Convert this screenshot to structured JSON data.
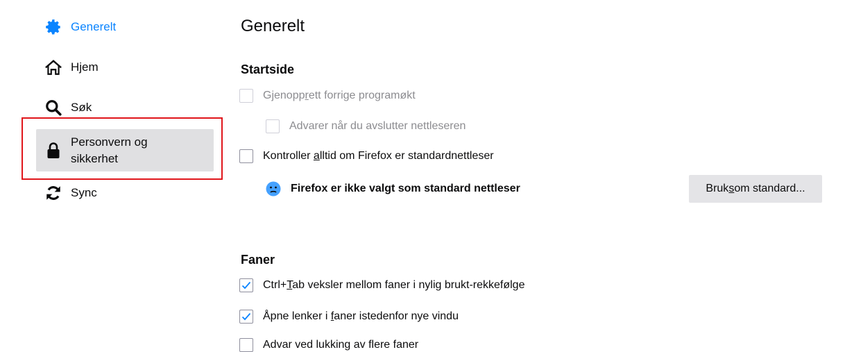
{
  "sidebar": {
    "items": [
      {
        "label": "Generelt",
        "icon": "gear-icon"
      },
      {
        "label": "Hjem",
        "icon": "home-icon"
      },
      {
        "label": "Søk",
        "icon": "search-icon"
      },
      {
        "label_line1": "Personvern og",
        "label_line2": "sikkerhet",
        "icon": "lock-icon"
      },
      {
        "label": "Sync",
        "icon": "sync-icon"
      }
    ]
  },
  "main": {
    "title": "Generelt",
    "startup": {
      "heading": "Startside",
      "restore_session": {
        "pre": "Gjenopp",
        "u": "r",
        "post": "ett forrige programøkt"
      },
      "warn_on_quit": "Advarer når du avslutter nettleseren",
      "check_default": {
        "pre": "Kontroller ",
        "u": "a",
        "post": "lltid om Firefox er standardnettleser"
      },
      "status": "Firefox er ikke valgt som standard nettleser",
      "make_default": {
        "pre": "Bruk ",
        "u": "s",
        "post": "om standard..."
      }
    },
    "tabs": {
      "heading": "Faner",
      "ctrl_tab": {
        "pre": "Ctrl+",
        "u": "T",
        "post": "ab veksler mellom faner i nylig brukt-rekkefølge"
      },
      "open_links": {
        "pre": "Åpne lenker i ",
        "u": "f",
        "post": "aner istedenfor nye vindu"
      },
      "warn_close": "Advar ved lukking av flere faner"
    }
  },
  "colors": {
    "accent": "#0a84ff",
    "highlight": "#e0161b",
    "status_icon": "#45a1ff"
  }
}
